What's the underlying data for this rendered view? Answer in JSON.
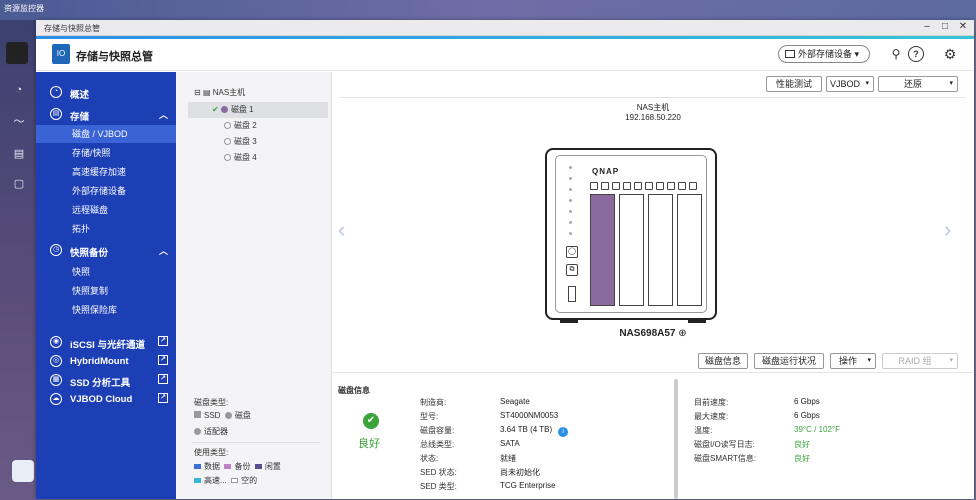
{
  "desktop": {
    "title": "资源监控器"
  },
  "window": {
    "title": "存储与快照总管",
    "minimize": "–",
    "maximize": "□",
    "close": "✕"
  },
  "header": {
    "app_title": "存储与快照总管",
    "external_device_label": "外部存储设备"
  },
  "sidebar": {
    "overview": "概述",
    "storage": "存储",
    "storage_items": [
      "磁盘 / VJBOD",
      "存储/快照",
      "高速缓存加速",
      "外部存储设备",
      "远程磁盘",
      "拓扑"
    ],
    "snapshot_backup": "快照备份",
    "snapshot_items": [
      "快照",
      "快照复制",
      "快照保险库"
    ],
    "links": [
      "iSCSI 与光纤通道",
      "HybridMount",
      "SSD 分析工具",
      "VJBOD Cloud"
    ]
  },
  "tree": {
    "root": "NAS主机",
    "disks": [
      "磁盘 1",
      "磁盘 2",
      "磁盘 3",
      "磁盘 4"
    ],
    "disk_type_title": "磁盘类型:",
    "disk_types": [
      "SSD",
      "磁盘",
      "适配器"
    ],
    "usage_title": "使用类型:",
    "usage_types": [
      {
        "label": "数据",
        "color": "#3b6fd6"
      },
      {
        "label": "备份",
        "color": "#c080c8"
      },
      {
        "label": "闲置",
        "color": "#5c4d8f"
      },
      {
        "label": "高速...",
        "color": "#37b6d6"
      },
      {
        "label": "空的",
        "color": "#ffffff"
      }
    ]
  },
  "toolbar": {
    "perf_test": "性能测试",
    "vjbod": "VJBOD",
    "restore": "还原"
  },
  "nas": {
    "name": "NAS主机",
    "ip": "192.168.50.220",
    "brand": "QNAP",
    "model": "NAS698A57"
  },
  "actions": {
    "disk_info": "磁盘信息",
    "disk_health": "磁盘运行状况",
    "operation": "操作",
    "raid_group": "RAID 组"
  },
  "disk_info": {
    "section_title": "磁盘信息",
    "status": "良好",
    "left": [
      {
        "label": "制造商:",
        "value": "Seagate"
      },
      {
        "label": "型号:",
        "value": "ST4000NM0053"
      },
      {
        "label": "磁盘容量:",
        "value": "3.64 TB (4 TB)"
      },
      {
        "label": "总线类型:",
        "value": "SATA"
      },
      {
        "label": "状态:",
        "value": "就绪"
      },
      {
        "label": "SED 状态:",
        "value": "尚未初始化"
      },
      {
        "label": "SED 类型:",
        "value": "TCG Enterprise"
      }
    ],
    "right": [
      {
        "label": "目前速度:",
        "value": "6 Gbps"
      },
      {
        "label": "最大速度:",
        "value": "6 Gbps"
      },
      {
        "label": "温度:",
        "value": "39°C / 102°F"
      },
      {
        "label": "磁盘I/O读写日志:",
        "value": "良好"
      },
      {
        "label": "磁盘SMART信息:",
        "value": "良好"
      }
    ]
  }
}
